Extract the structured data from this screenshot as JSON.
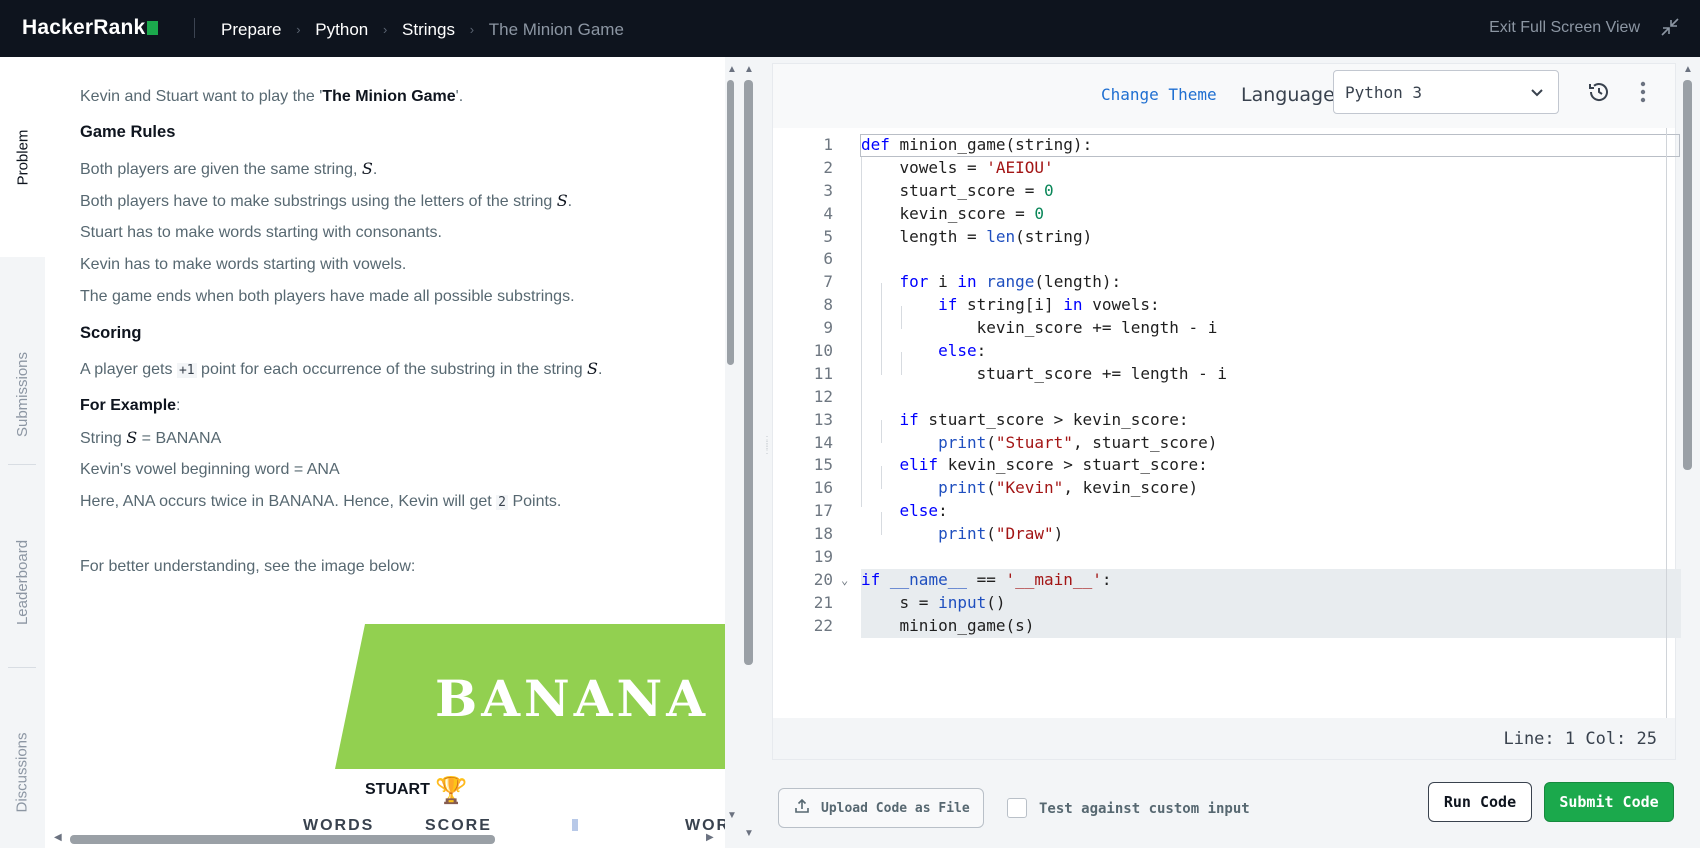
{
  "topbar": {
    "logo": "HackerRank",
    "breadcrumb": [
      "Prepare",
      "Python",
      "Strings"
    ],
    "breadcrumb_current": "The Minion Game",
    "exit_fullscreen": "Exit Full Screen View"
  },
  "rail": {
    "tabs": [
      "Problem",
      "Submissions",
      "Leaderboard",
      "Discussions"
    ]
  },
  "problem": {
    "intro_pre": "Kevin and Stuart want to play the '",
    "intro_game": "The Minion Game",
    "intro_post": "'.",
    "rules_heading": "Game Rules",
    "rule1": "Both players are given the same string, ",
    "rule2": "Both players have to make substrings using the letters of the string ",
    "rule3": "Stuart has to make words starting with consonants.",
    "rule4": "Kevin has to make words starting with vowels.",
    "rule5": "The game ends when both players have made all possible substrings.",
    "math_s": "S",
    "period": ".",
    "scoring_heading": "Scoring",
    "scoring_pre": "A player gets ",
    "scoring_point": "+1",
    "scoring_post": " point for each occurrence of the substring in the string ",
    "example_heading": "For Example",
    "colon": ":",
    "ex_string_pre": "String ",
    "ex_string_post": " = BANANA",
    "ex_vowel": "Kevin's vowel beginning word = ANA",
    "ex_here_pre": "Here, ANA occurs twice in BANANA. Hence, Kevin will get ",
    "ex_points_num": "2",
    "ex_here_post": " Points.",
    "understanding": "For better understanding, see the image below:",
    "image": {
      "banner": "BANANA",
      "player": "STUART",
      "col_words": "WORDS",
      "col_score": "SCORE",
      "col_words2": "WOR"
    }
  },
  "editor": {
    "change_theme": "Change Theme",
    "language_label": "Language",
    "language_value": "Python 3",
    "status": "Line: 1 Col: 25",
    "line_numbers": [
      "1",
      "2",
      "3",
      "4",
      "5",
      "6",
      "7",
      "8",
      "9",
      "10",
      "11",
      "12",
      "13",
      "14",
      "15",
      "16",
      "17",
      "18",
      "19",
      "20",
      "21",
      "22"
    ]
  },
  "actions": {
    "upload": "Upload Code as File",
    "custom_input": "Test against custom input",
    "run": "Run Code",
    "submit": "Submit Code"
  },
  "colors": {
    "topbar_bg": "#0e141e",
    "brand_green": "#1ba94c",
    "link_blue": "#1f6fd1",
    "banner_green": "#92d050"
  }
}
